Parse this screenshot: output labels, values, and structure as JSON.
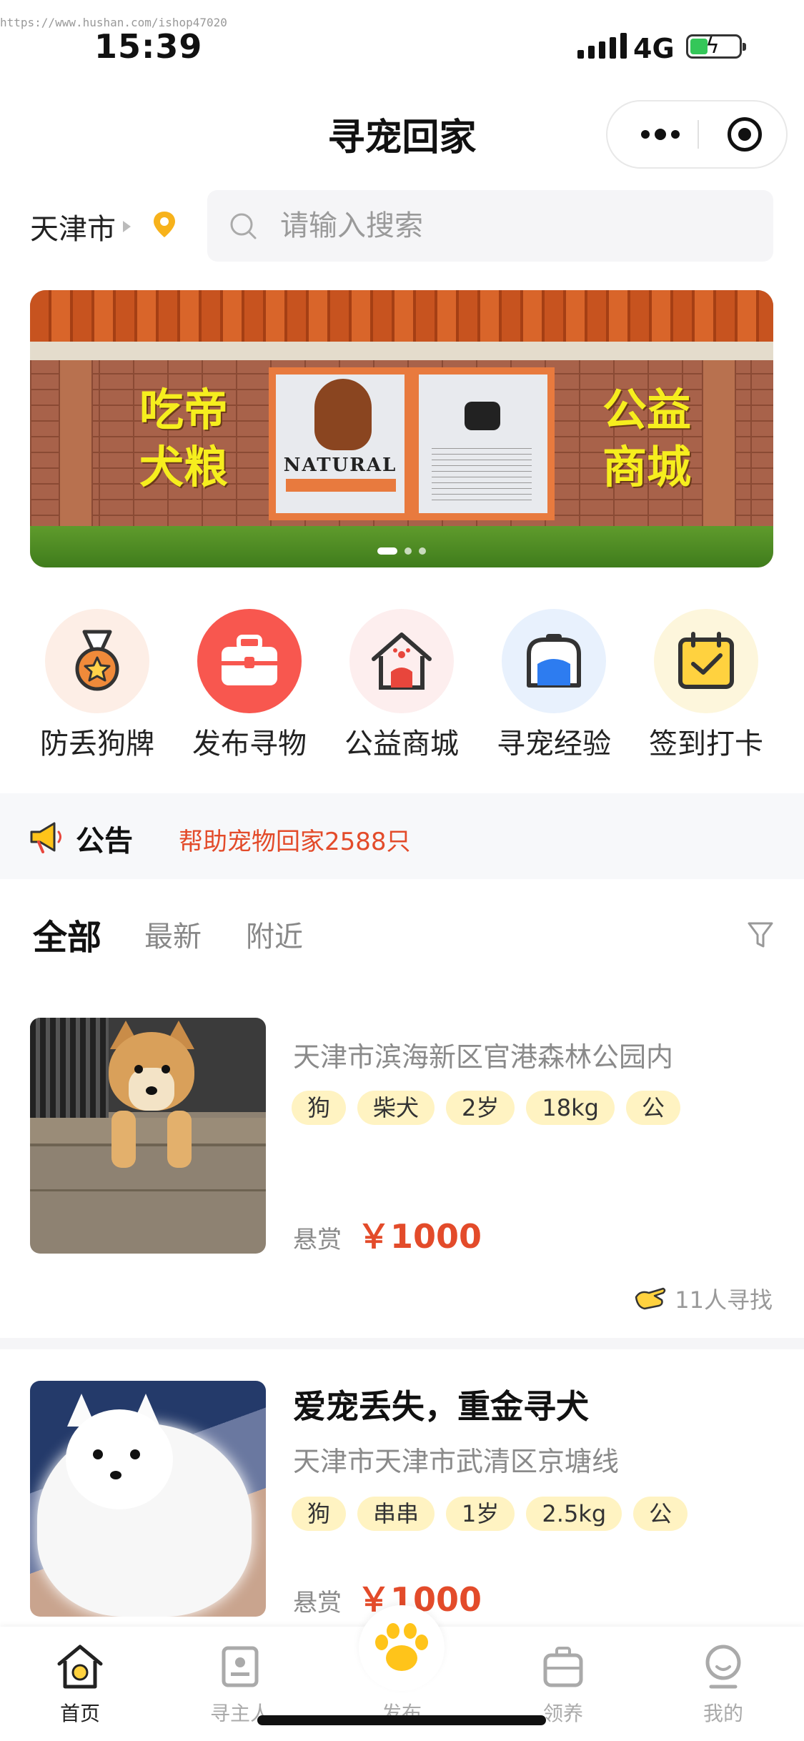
{
  "watermark": "https://www.hushan.com/ishop47020",
  "status_bar": {
    "time": "15:39",
    "network": "4G"
  },
  "nav": {
    "title": "寻宠回家"
  },
  "location": {
    "city": "天津市"
  },
  "search": {
    "placeholder": "请输入搜索"
  },
  "banner": {
    "left_text_line1": "吃帝",
    "left_text_line2": "犬粮",
    "right_text_line1": "公益",
    "right_text_line2": "商城",
    "bag_brand": "NATURAL",
    "active_slide": 1,
    "slide_count": 3
  },
  "quick_menu": [
    {
      "label": "防丢狗牌",
      "icon": "medal-icon",
      "bg": "#fdeee6"
    },
    {
      "label": "发布寻物",
      "icon": "briefcase-icon",
      "bg": "#f8574f"
    },
    {
      "label": "公益商城",
      "icon": "pet-house-icon",
      "bg": "#fdeeee"
    },
    {
      "label": "寻宠经验",
      "icon": "pet-carrier-icon",
      "bg": "#e8f1fd"
    },
    {
      "label": "签到打卡",
      "icon": "calendar-check-icon",
      "bg": "#fdf6dc"
    }
  ],
  "notice": {
    "title": "公告",
    "text": "帮助宠物回家2588只"
  },
  "tabs": [
    {
      "label": "全部",
      "active": true
    },
    {
      "label": "最新",
      "active": false
    },
    {
      "label": "附近",
      "active": false
    }
  ],
  "posts": [
    {
      "title": "",
      "address": "天津市滨海新区官港森林公园内",
      "tags": [
        "狗",
        "柴犬",
        "2岁",
        "18kg",
        "公"
      ],
      "reward_label": "悬赏",
      "reward_amount": "￥1000",
      "seekers": "11人寻找",
      "photo": "shiba-photo"
    },
    {
      "title": "爱宠丢失，重金寻犬",
      "address": "天津市天津市武清区京塘线",
      "tags": [
        "狗",
        "串串",
        "1岁",
        "2.5kg",
        "公"
      ],
      "reward_label": "悬赏",
      "reward_amount": "￥1000",
      "seekers": "",
      "photo": "spitz-photo"
    }
  ],
  "tabbar": [
    {
      "label": "首页",
      "icon": "home-icon",
      "active": true
    },
    {
      "label": "寻主人",
      "icon": "id-card-icon",
      "active": false
    },
    {
      "label": "发布",
      "icon": "paw-icon",
      "active": false
    },
    {
      "label": "领养",
      "icon": "carrier-icon",
      "active": false
    },
    {
      "label": "我的",
      "icon": "user-icon",
      "active": false
    }
  ],
  "colors": {
    "accent": "#e34b2a",
    "tag_bg": "#fff3c2",
    "brand_yellow": "#f7c51c"
  }
}
